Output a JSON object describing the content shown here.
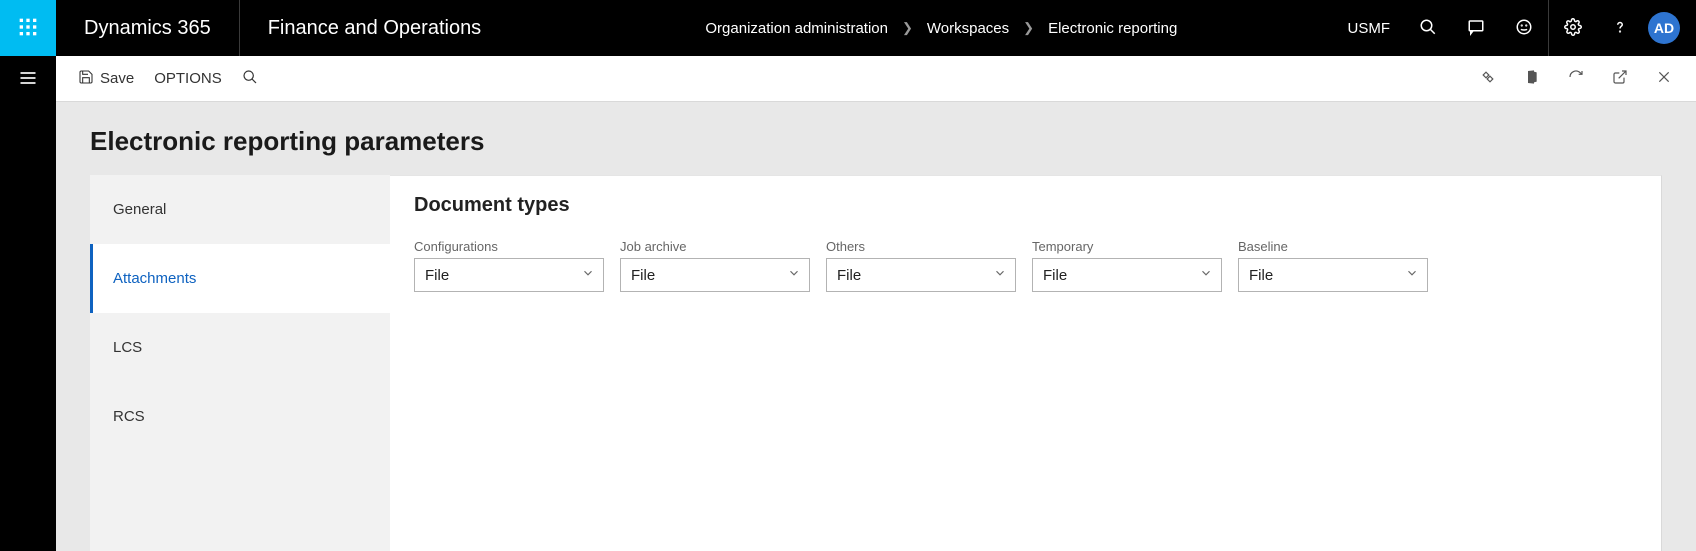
{
  "header": {
    "brand": "Dynamics 365",
    "app": "Finance and Operations",
    "breadcrumb": [
      "Organization administration",
      "Workspaces",
      "Electronic reporting"
    ],
    "company": "USMF",
    "avatar": "AD"
  },
  "toolbar": {
    "save_label": "Save",
    "options_label": "OPTIONS"
  },
  "page": {
    "title": "Electronic reporting parameters",
    "section_title": "Document types"
  },
  "tabs": [
    {
      "label": "General",
      "active": false
    },
    {
      "label": "Attachments",
      "active": true
    },
    {
      "label": "LCS",
      "active": false
    },
    {
      "label": "RCS",
      "active": false
    }
  ],
  "fields": [
    {
      "label": "Configurations",
      "value": "File"
    },
    {
      "label": "Job archive",
      "value": "File"
    },
    {
      "label": "Others",
      "value": "File"
    },
    {
      "label": "Temporary",
      "value": "File"
    },
    {
      "label": "Baseline",
      "value": "File"
    }
  ]
}
